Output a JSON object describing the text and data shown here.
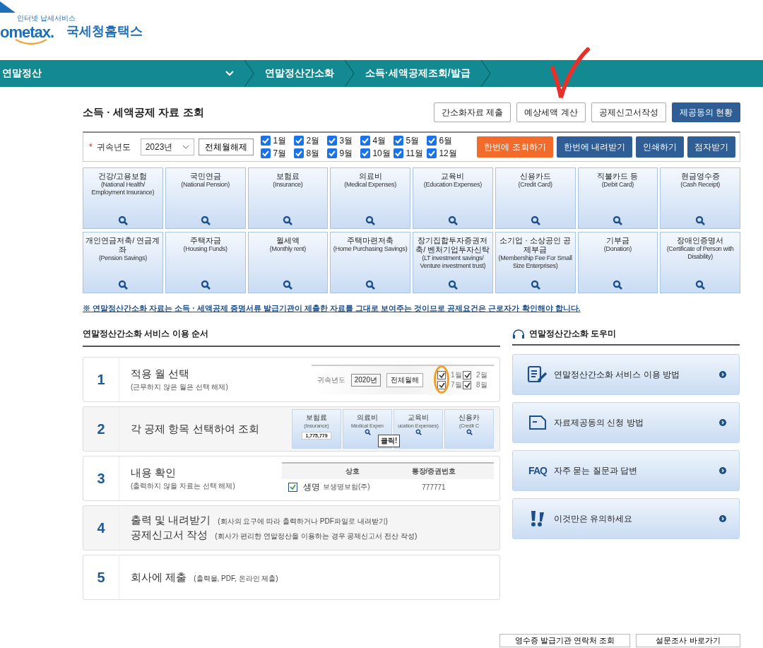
{
  "logo": {
    "tagline": "인터넷 납세서비스",
    "brand": "ometax.",
    "name": "국세청홈택스"
  },
  "nav": [
    {
      "label": "연말정산",
      "kind": "menu"
    },
    {
      "label": "연말정산간소화",
      "kind": "crumb"
    },
    {
      "label": "소득·세액공제조회/발급",
      "kind": "crumb"
    }
  ],
  "page_title": "소득 · 세액공제 자료 조회",
  "top_buttons": [
    {
      "label": "간소화자료 제출",
      "kind": "outline"
    },
    {
      "label": "예상세액 계산",
      "kind": "outline"
    },
    {
      "label": "공제신고서작성",
      "kind": "outline"
    },
    {
      "label": "제공동의 현황",
      "kind": "primary"
    }
  ],
  "filter": {
    "required_mark": "*",
    "year_label": "귀속년도",
    "year": "2023년",
    "clear_button": "전체월해제",
    "months": [
      {
        "label": "1월",
        "checked": true
      },
      {
        "label": "2월",
        "checked": true
      },
      {
        "label": "3월",
        "checked": true
      },
      {
        "label": "4월",
        "checked": true
      },
      {
        "label": "5월",
        "checked": true
      },
      {
        "label": "6월",
        "checked": true
      },
      {
        "label": "7월",
        "checked": true
      },
      {
        "label": "8월",
        "checked": true
      },
      {
        "label": "9월",
        "checked": true
      },
      {
        "label": "10월",
        "checked": true
      },
      {
        "label": "11월",
        "checked": true
      },
      {
        "label": "12월",
        "checked": true
      }
    ],
    "actions": [
      {
        "label": "한번에 조회하기",
        "kind": "orange"
      },
      {
        "label": "한번에 내려받기",
        "kind": "blue"
      },
      {
        "label": "인쇄하기",
        "kind": "blue"
      },
      {
        "label": "점자받기",
        "kind": "blue"
      }
    ]
  },
  "categories": [
    {
      "title": "건강/고용보험",
      "subtitle": "(National Health/ Employment Insurance)"
    },
    {
      "title": "국민연금",
      "subtitle": "(National Pension)"
    },
    {
      "title": "보험료",
      "subtitle": "(Insurance)"
    },
    {
      "title": "의료비",
      "subtitle": "(Medical Expenses)"
    },
    {
      "title": "교육비",
      "subtitle": "(Education Expenses)"
    },
    {
      "title": "신용카드",
      "subtitle": "(Credit Card)"
    },
    {
      "title": "직불카드 등",
      "subtitle": "(Debit Card)"
    },
    {
      "title": "현금영수증",
      "subtitle": "(Cash Receipt)"
    },
    {
      "title": "개인연금저축/ 연금계좌",
      "subtitle": "(Pension Savings)"
    },
    {
      "title": "주택자금",
      "subtitle": "(Housing Funds)"
    },
    {
      "title": "월세액",
      "subtitle": "(Monthly rent)"
    },
    {
      "title": "주택마련저축",
      "subtitle": "(Home Purchasing Savings)"
    },
    {
      "title": "장기집합투자증권저축/ 벤처기업투자신탁",
      "subtitle": "(LT investment savings/ Venture investment trust)"
    },
    {
      "title": "소기업 · 소상공인 공제부금",
      "subtitle": "(Membership Fee For Small Size Enterprises)"
    },
    {
      "title": "기부금",
      "subtitle": "(Donation)"
    },
    {
      "title": "장애인증명서",
      "subtitle": "(Certificate of Person with Disability)"
    }
  ],
  "notice": "※ 연말정산간소화 자료는 소득 · 세액공제 증명서류 발급기관이 제출한 자료를 그대로 보여주는 것이므로 공제요건은 근로자가 확인해야 합니다.",
  "steps_title": "연말정산간소화 서비스 이용 순서",
  "steps": [
    {
      "number": "1",
      "lines": [
        {
          "title": "적용 월 선택"
        }
      ],
      "desc": "(근무하지 않은 월은 선택 해제)",
      "preview": {
        "kind": "months",
        "year_label": "귀속년도",
        "year": "2020년",
        "button": "전체월해",
        "months": [
          {
            "label": "1월",
            "checked": true
          },
          {
            "label": "7월",
            "checked": true
          },
          {
            "label": "2월",
            "checked": true
          },
          {
            "label": "8월",
            "checked": true
          }
        ]
      }
    },
    {
      "number": "2",
      "lines": [
        {
          "title": "각 공제 항목 선택하여 조회"
        }
      ],
      "preview": {
        "kind": "cards",
        "cards": [
          {
            "title": "보험료",
            "subtitle": "(Insurance)",
            "amount": "1,775,779"
          },
          {
            "title": "의료비",
            "subtitle": "Medical Expen"
          },
          {
            "title": "교육비",
            "subtitle": "ucation Expenses)"
          },
          {
            "title": "신용카",
            "subtitle": "(Credit C"
          }
        ],
        "tooltip": "클릭!"
      }
    },
    {
      "number": "3",
      "lines": [
        {
          "title": "내용 확인"
        }
      ],
      "desc": "(출력하지 않을 자료는 선택 해제)",
      "preview": {
        "kind": "table",
        "columns": [
          "상호",
          "통장/증권번호"
        ],
        "row": {
          "checked": true,
          "tag": "생명",
          "name": "보생명보험(주)",
          "number": "777771"
        }
      }
    },
    {
      "number": "4",
      "lines": [
        {
          "title": "출력 및 내려받기",
          "note": "(회사의 요구에 따라 출력하거나 PDF파일로 내려받기)"
        },
        {
          "title": "공제신고서 작성",
          "note": "(회사가 편리한 연말정산을 이용하는 경우 공제신고서 전산 작성)"
        }
      ]
    },
    {
      "number": "5",
      "lines": [
        {
          "title": "회사에 제출",
          "note": "(출력물, PDF, 온라인 제출)"
        }
      ]
    }
  ],
  "help": {
    "title": "연말정산간소화 도우미",
    "items": [
      {
        "label": "연말정산간소화 서비스 이용 방법",
        "kind": "guide"
      },
      {
        "label": "자료제공동의 신청 방법",
        "kind": "form"
      },
      {
        "label": "자주 묻는 질문과 답변",
        "kind": "faq",
        "icon_text": "FAQ"
      },
      {
        "label": "이것만은 유의하세요",
        "kind": "warning"
      }
    ]
  },
  "footer_buttons": [
    "영수증 발급기관 연락처 조회",
    "설문조사 바로가기"
  ]
}
